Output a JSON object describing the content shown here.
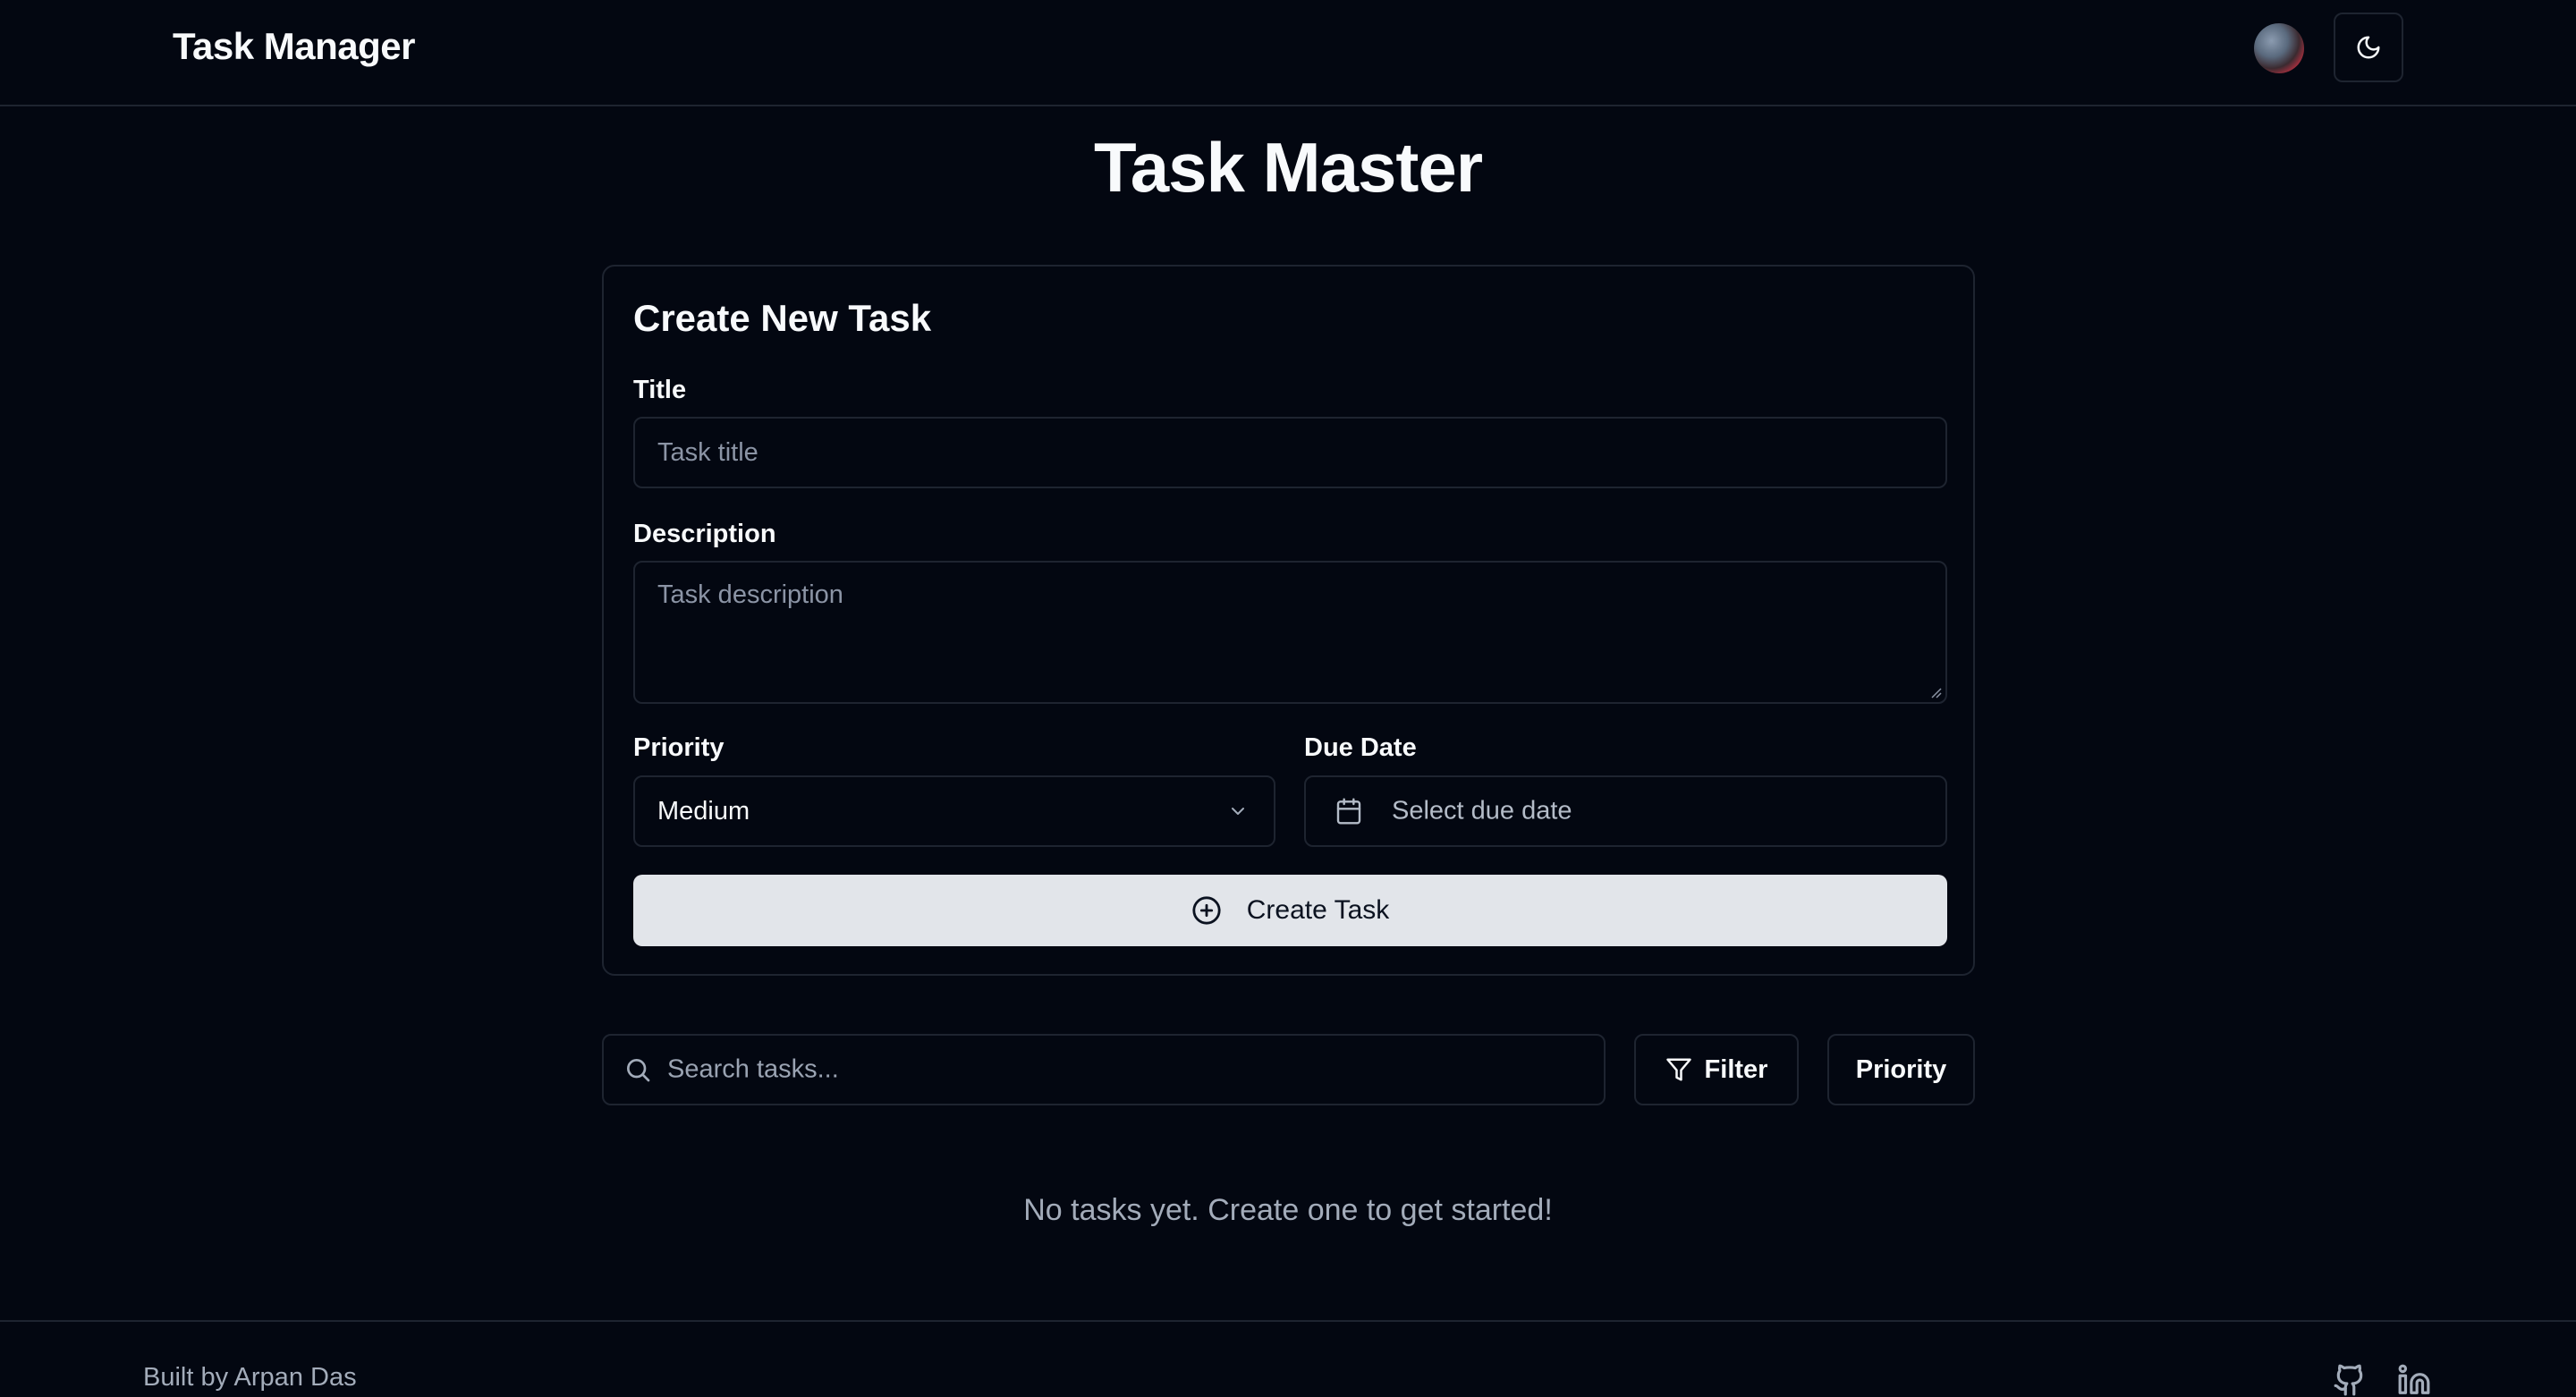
{
  "header": {
    "brand": "Task Manager",
    "avatar_alt": "user avatar",
    "theme_icon": "moon-icon"
  },
  "main": {
    "title": "Task Master"
  },
  "form": {
    "heading": "Create New Task",
    "title_label": "Title",
    "title_placeholder": "Task title",
    "description_label": "Description",
    "description_placeholder": "Task description",
    "priority_label": "Priority",
    "priority_value": "Medium",
    "due_label": "Due Date",
    "due_placeholder": "Select due date",
    "submit_label": "Create Task"
  },
  "toolbar": {
    "search_placeholder": "Search tasks...",
    "filter_label": "Filter",
    "priority_label": "Priority"
  },
  "empty_state": "No tasks yet. Create one to get started!",
  "footer": {
    "credit": "Built by Arpan Das",
    "icons": [
      "github-icon",
      "linkedin-icon"
    ]
  },
  "colors": {
    "background": "#030711",
    "border": "#1e2430",
    "text": "#f8fafc",
    "muted": "#a3acba",
    "button_bg": "#e2e5ea"
  }
}
